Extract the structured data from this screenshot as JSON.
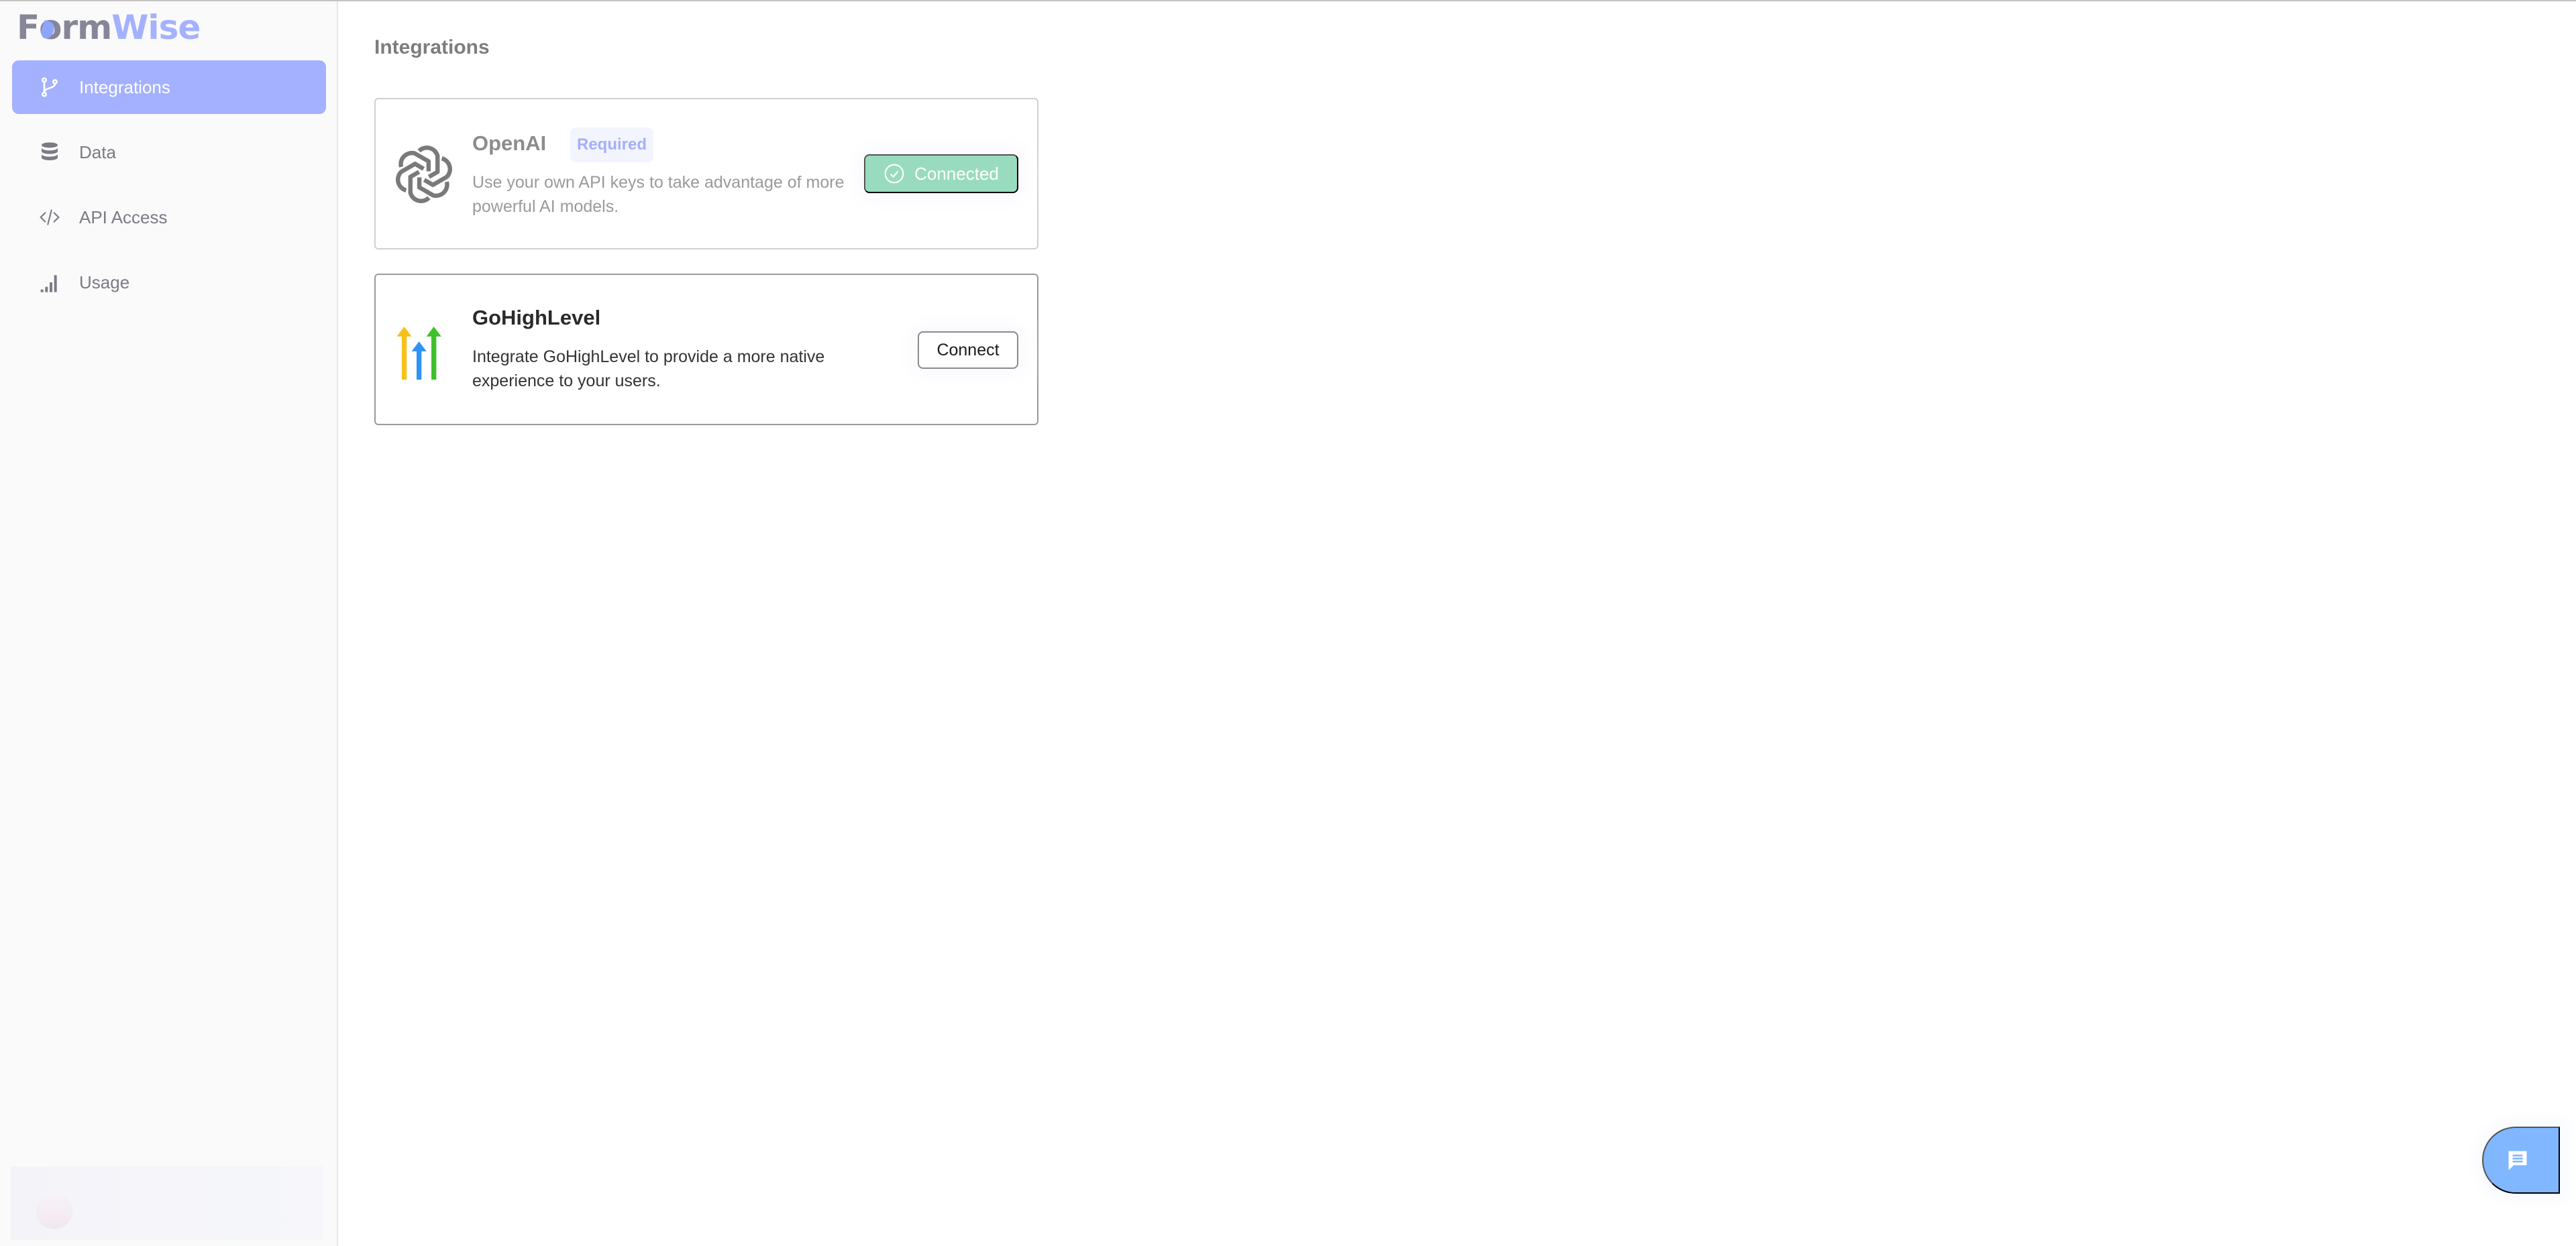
{
  "app": {
    "logo_part1": "F",
    "logo_o": "o",
    "logo_part2": "rm",
    "logo_part3": "Wise"
  },
  "sidebar": {
    "items": [
      {
        "label": "Integrations",
        "icon": "git-branch-icon",
        "active": true
      },
      {
        "label": "Data",
        "icon": "database-icon",
        "active": false
      },
      {
        "label": "API Access",
        "icon": "code-icon",
        "active": false
      },
      {
        "label": "Usage",
        "icon": "signal-bars-icon",
        "active": false
      }
    ]
  },
  "main": {
    "title": "Integrations",
    "integrations": [
      {
        "name": "OpenAI",
        "badge": "Required",
        "description": "Use your own API keys to take advantage of more powerful AI models.",
        "action_label": "Connected",
        "status": "connected"
      },
      {
        "name": "GoHighLevel",
        "description": "Integrate GoHighLevel to provide a more native experience to your users.",
        "action_label": "Connect",
        "status": "not-connected"
      }
    ]
  },
  "colors": {
    "accent": "#a3b1ff",
    "connected": "#99dbbe",
    "chat": "#80b7ff"
  }
}
